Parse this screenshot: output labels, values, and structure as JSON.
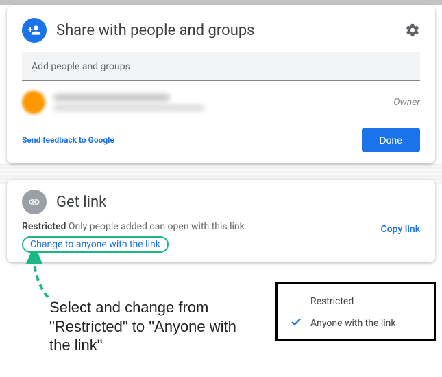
{
  "share": {
    "title": "Share with people and groups",
    "input_placeholder": "Add people and groups",
    "owner_label": "Owner",
    "feedback": "Send feedback to Google",
    "done": "Done"
  },
  "link": {
    "title": "Get link",
    "restricted_label": "Restricted",
    "restricted_desc": "Only people added can open with this link",
    "change": "Change to anyone with the link",
    "copy": "Copy link"
  },
  "annotation": {
    "text": "Select and change from \"Restricted\" to \"Anyone with the link\""
  },
  "menu": {
    "option_restricted": "Restricted",
    "option_anyone": "Anyone with the link"
  }
}
